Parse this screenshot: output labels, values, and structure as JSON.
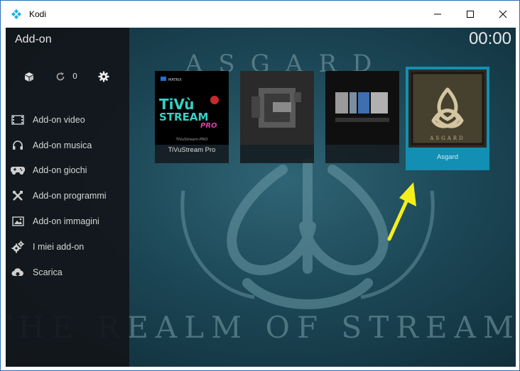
{
  "window": {
    "title": "Kodi"
  },
  "header": {
    "title": "Add-on",
    "clock": "00:00"
  },
  "toolbar": {
    "updates_count": "0"
  },
  "menu": {
    "items": [
      {
        "label": "Add-on video",
        "icon": "film-icon"
      },
      {
        "label": "Add-on musica",
        "icon": "headphones-icon"
      },
      {
        "label": "Add-on giochi",
        "icon": "gamepad-icon"
      },
      {
        "label": "Add-on programmi",
        "icon": "tools-icon"
      },
      {
        "label": "Add-on immagini",
        "icon": "picture-icon"
      },
      {
        "label": "I miei add-on",
        "icon": "gears-icon"
      },
      {
        "label": "Scarica",
        "icon": "cloud-download-icon"
      }
    ]
  },
  "addons": [
    {
      "name": "TiVuStream Pro",
      "logo_line1": "TiVù",
      "logo_line2": "STREAM",
      "logo_line3": "PRO",
      "logo_caption": "TiVuStream-PRO",
      "logo_brand": "MATRIX",
      "focused": false
    },
    {
      "name": "",
      "focused": false
    },
    {
      "name": "",
      "focused": false
    },
    {
      "name": "Asgard",
      "logo_caption": "ASGARD",
      "focused": true
    }
  ],
  "fanart": {
    "top_text": "ASGARD",
    "bottom_text": "THE REALM OF STREAMING"
  },
  "colors": {
    "focus": "#138fb3",
    "sidebar": "#12161a",
    "arrow": "#f5ee1d"
  }
}
